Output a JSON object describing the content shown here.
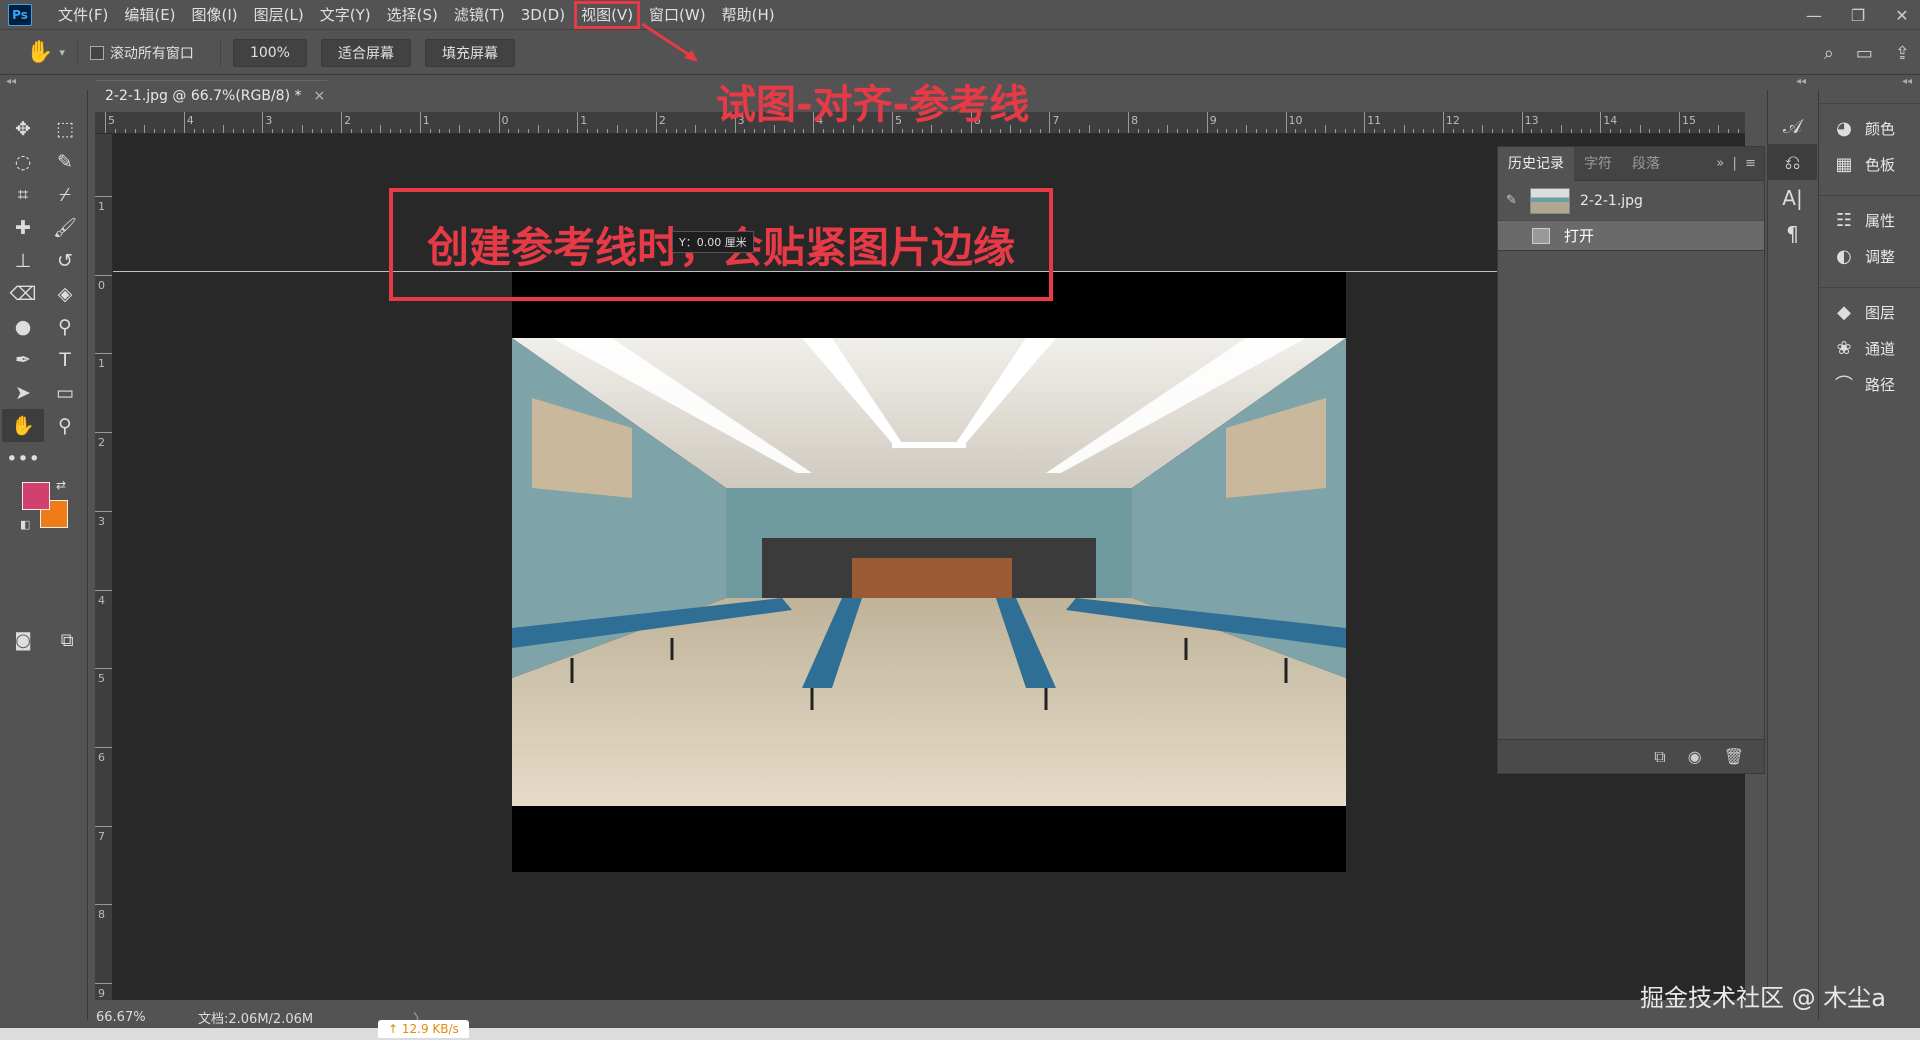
{
  "menu": {
    "logo": "Ps",
    "items": [
      "文件(F)",
      "编辑(E)",
      "图像(I)",
      "图层(L)",
      "文字(Y)",
      "选择(S)",
      "滤镜(T)",
      "3D(D)",
      "视图(V)",
      "窗口(W)",
      "帮助(H)"
    ],
    "highlighted_index": 8
  },
  "window_controls": {
    "minimize": "—",
    "restore": "❐",
    "close": "✕"
  },
  "options": {
    "scroll_all_label": "滚动所有窗口",
    "zoom_btn": "100%",
    "fit_screen_btn": "适合屏幕",
    "fill_screen_btn": "填充屏幕"
  },
  "document": {
    "tab_title": "2-2-1.jpg @ 66.7%(RGB/8) *",
    "close": "×"
  },
  "rulers": {
    "top": [
      "5",
      "4",
      "3",
      "2",
      "1",
      "0",
      "1",
      "2",
      "3",
      "4",
      "5",
      "6",
      "7",
      "8",
      "9",
      "10",
      "11",
      "12",
      "13",
      "14",
      "15"
    ],
    "left": [
      "1",
      "0",
      "1",
      "2",
      "3",
      "4",
      "5",
      "6",
      "7",
      "8",
      "9"
    ]
  },
  "annotation": {
    "title": "试图-对齐-参考线",
    "box_text": "创建参考线时，会贴紧图片边缘",
    "y_readout": "Y：0.00 厘米"
  },
  "history_panel": {
    "tabs": [
      "历史记录",
      "字符",
      "段落"
    ],
    "snapshot_name": "2-2-1.jpg",
    "steps": [
      "打开"
    ]
  },
  "right_panel": {
    "groups": [
      [
        {
          "icon": "color-icon",
          "label": "颜色"
        },
        {
          "icon": "swatches-icon",
          "label": "色板"
        }
      ],
      [
        {
          "icon": "properties-icon",
          "label": "属性"
        },
        {
          "icon": "adjustments-icon",
          "label": "调整"
        }
      ],
      [
        {
          "icon": "layers-icon",
          "label": "图层"
        },
        {
          "icon": "channels-icon",
          "label": "通道"
        },
        {
          "icon": "paths-icon",
          "label": "路径"
        }
      ]
    ]
  },
  "colors": {
    "foreground": "#d2416d",
    "background": "#ef7c17",
    "annotation": "#e63a47"
  },
  "status": {
    "zoom": "66.67%",
    "doc": "文档:2.06M/2.06M",
    "arrow": "〉",
    "net_speed": "↑ 12.9 KB/s"
  },
  "watermark": "掘金技术社区 @ 木尘a"
}
